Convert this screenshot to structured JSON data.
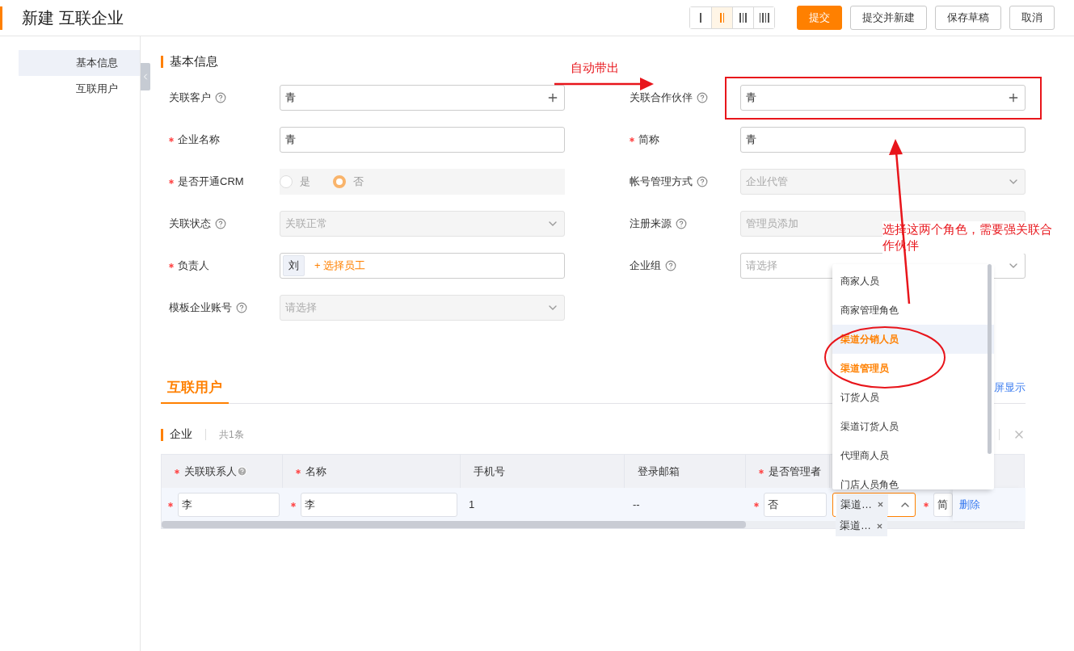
{
  "header": {
    "title": "新建 互联企业",
    "layout_options": [
      {
        "selected": false
      },
      {
        "selected": true
      },
      {
        "selected": false
      },
      {
        "selected": false
      }
    ],
    "buttons": [
      {
        "label": "提交",
        "kind": "primary"
      },
      {
        "label": "提交并新建",
        "kind": "default"
      },
      {
        "label": "保存草稿",
        "kind": "default"
      },
      {
        "label": "取消",
        "kind": "default"
      }
    ]
  },
  "sidebar": {
    "items": [
      {
        "label": "基本信息",
        "selected": true
      },
      {
        "label": "互联用户",
        "selected": false
      }
    ]
  },
  "section_title": "基本信息",
  "fields": [
    {
      "label": "关联客户",
      "required": false,
      "help": true,
      "kind": "lookup",
      "value": "青",
      "disabled": false
    },
    {
      "label": "关联合作伙伴",
      "required": false,
      "help": true,
      "kind": "lookup",
      "value": "青",
      "disabled": false
    },
    {
      "label": "企业名称",
      "required": true,
      "help": false,
      "kind": "text",
      "value": "青",
      "disabled": false
    },
    {
      "label": "简称",
      "required": true,
      "help": false,
      "kind": "text",
      "value": "青",
      "disabled": false
    },
    {
      "label": "是否开通CRM",
      "required": true,
      "help": false,
      "kind": "radio",
      "disabled": true,
      "options": [
        {
          "label": "是",
          "selected": false
        },
        {
          "label": "否",
          "selected": true
        }
      ]
    },
    {
      "label": "帐号管理方式",
      "required": false,
      "help": true,
      "kind": "select",
      "value": "企业代管",
      "disabled": true
    },
    {
      "label": "关联状态",
      "required": false,
      "help": true,
      "kind": "select",
      "value": "关联正常",
      "disabled": true
    },
    {
      "label": "注册来源",
      "required": false,
      "help": true,
      "kind": "text",
      "value": "管理员添加",
      "disabled": true
    },
    {
      "label": "负责人",
      "required": true,
      "help": false,
      "kind": "people",
      "tags": [
        "刘"
      ],
      "action": "+ 选择员工",
      "disabled": false
    },
    {
      "label": "企业组",
      "required": false,
      "help": true,
      "kind": "select",
      "placeholder": "请选择",
      "disabled": false
    },
    {
      "label": "模板企业账号",
      "required": false,
      "help": true,
      "kind": "select",
      "placeholder": "请选择",
      "disabled": true
    }
  ],
  "tabs": [
    {
      "label": "互联用户",
      "selected": true
    }
  ],
  "tab_link": "屏显示",
  "subsection": {
    "title": "企业",
    "count": "共1条"
  },
  "table": {
    "columns": [
      {
        "label": "关联联系人",
        "required": true,
        "help": true
      },
      {
        "label": "名称",
        "required": true,
        "help": false
      },
      {
        "label": "手机号",
        "required": false,
        "help": false
      },
      {
        "label": "登录邮箱",
        "required": false,
        "help": false
      },
      {
        "label": "是否管理者",
        "required": true,
        "help": false
      }
    ],
    "rows": [
      {
        "cells": [
          {
            "kind": "input",
            "value": "李",
            "required": true
          },
          {
            "kind": "input",
            "value": "李",
            "required": true
          },
          {
            "kind": "text",
            "value": "1"
          },
          {
            "kind": "text",
            "value": "--"
          },
          {
            "kind": "input",
            "value": "否",
            "required": true
          },
          {
            "kind": "multiselect",
            "tags": [
              "渠道…",
              "渠道…"
            ],
            "expanded": true
          },
          {
            "kind": "input",
            "value": "简",
            "required": true
          },
          {
            "kind": "link",
            "value": "删除"
          }
        ]
      }
    ]
  },
  "dropdown": {
    "options": [
      {
        "label": "商家人员",
        "selected": false,
        "highlighted": false
      },
      {
        "label": "商家管理角色",
        "selected": false,
        "highlighted": false
      },
      {
        "label": "渠道分销人员",
        "selected": true,
        "highlighted": true
      },
      {
        "label": "渠道管理员",
        "selected": true,
        "highlighted": false
      },
      {
        "label": "订货人员",
        "selected": false,
        "highlighted": false
      },
      {
        "label": "渠道订货人员",
        "selected": false,
        "highlighted": false
      },
      {
        "label": "代理商人员",
        "selected": false,
        "highlighted": false
      },
      {
        "label": "门店人员角色",
        "selected": false,
        "highlighted": false
      }
    ]
  },
  "annotations": [
    {
      "kind": "auto",
      "text": "自动带出"
    },
    {
      "kind": "role",
      "lines": [
        "选择这两个角色，需要强关联合",
        "作伙伴"
      ]
    }
  ]
}
